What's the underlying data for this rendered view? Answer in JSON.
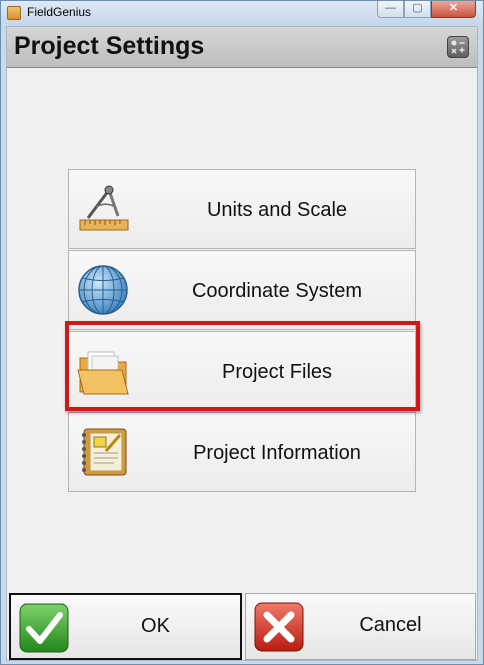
{
  "window": {
    "title": "FieldGenius",
    "min_glyph": "—",
    "max_glyph": "▢",
    "close_glyph": "✕"
  },
  "header": {
    "title": "Project Settings",
    "icon": "calculator-icon"
  },
  "menu": {
    "items": [
      {
        "label": "Units and Scale",
        "icon": "drafting-compass-icon"
      },
      {
        "label": "Coordinate System",
        "icon": "globe-icon"
      },
      {
        "label": "Project Files",
        "icon": "folder-icon",
        "highlighted": true
      },
      {
        "label": "Project Information",
        "icon": "notebook-icon"
      }
    ],
    "highlight_color": "#d01818"
  },
  "footer": {
    "ok_label": "OK",
    "ok_icon": "green-checkmark-icon",
    "cancel_label": "Cancel",
    "cancel_icon": "red-x-icon"
  }
}
